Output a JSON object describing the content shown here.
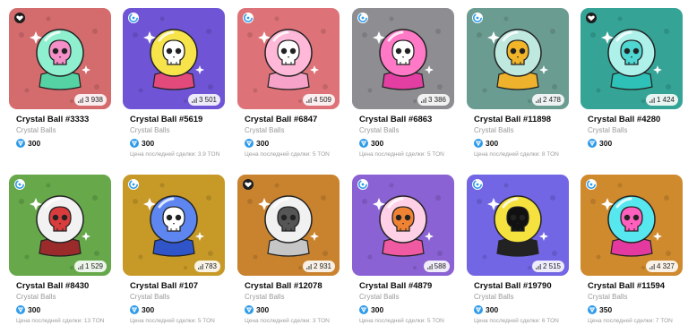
{
  "colors": {
    "ton": "#2f9bea",
    "name_text": "#0b0b0b",
    "muted_text": "#9a9a9a"
  },
  "cards": [
    {
      "name": "Crystal Ball #3333",
      "collection": "Crystal Balls",
      "price": "300",
      "count": "3 938",
      "last_sale": "",
      "mark": "heart-badge-icon",
      "bg": "#d46c6e",
      "ball": "#8ef0cf",
      "skull": "#f58fc8",
      "base": "#56d3a5"
    },
    {
      "name": "Crystal Ball #5619",
      "collection": "Crystal Balls",
      "price": "300",
      "count": "3 501",
      "last_sale": "Цена последней сделки: 3.9 TON",
      "mark": "verified-badge-icon",
      "bg": "#6f55d6",
      "ball": "#f7e34a",
      "skull": "#ffffff",
      "base": "#e34a7c"
    },
    {
      "name": "Crystal Ball #6847",
      "collection": "Crystal Balls",
      "price": "300",
      "count": "4 509",
      "last_sale": "Цена последней сделки: 5 TON",
      "mark": "verified-badge-icon",
      "bg": "#dd7378",
      "ball": "#ffb8d8",
      "skull": "#ffffff",
      "base": "#f7a3c9"
    },
    {
      "name": "Crystal Ball #6863",
      "collection": "Crystal Balls",
      "price": "300",
      "count": "3 386",
      "last_sale": "Цена последней сделки: 5 TON",
      "mark": "verified-badge-icon",
      "bg": "#8d8d92",
      "ball": "#ff79c6",
      "skull": "#ffffff",
      "base": "#e33fa3"
    },
    {
      "name": "Crystal Ball #11898",
      "collection": "Crystal Balls",
      "price": "300",
      "count": "2 478",
      "last_sale": "Цена последней сделки: 8 TON",
      "mark": "verified-badge-icon",
      "bg": "#6b9c91",
      "ball": "#bfe8de",
      "skull": "#f2b52a",
      "base": "#efb22c"
    },
    {
      "name": "Crystal Ball #4280",
      "collection": "Crystal Balls",
      "price": "300",
      "count": "1 424",
      "last_sale": "",
      "mark": "heart-badge-icon",
      "bg": "#35a396",
      "ball": "#aef0ea",
      "skull": "#4fd7d2",
      "base": "#2dc1b7"
    },
    {
      "name": "Crystal Ball #8430",
      "collection": "Crystal Balls",
      "price": "300",
      "count": "1 529",
      "last_sale": "Цена последней сделки: 13 TON",
      "mark": "verified-badge-icon",
      "bg": "#66a84a",
      "ball": "#f2f2f2",
      "skull": "#d93c3c",
      "base": "#9b2b2b"
    },
    {
      "name": "Crystal Ball #107",
      "collection": "Crystal Balls",
      "price": "300",
      "count": "783",
      "last_sale": "Цена последней сделки: 5 TON",
      "mark": "verified-badge-icon",
      "bg": "#c79a28",
      "ball": "#5e86f0",
      "skull": "#ffffff",
      "base": "#2f55c8"
    },
    {
      "name": "Crystal Ball #12078",
      "collection": "Crystal Balls",
      "price": "300",
      "count": "2 931",
      "last_sale": "Цена последней сделки: 3 TON",
      "mark": "heart-badge-icon",
      "bg": "#c9832f",
      "ball": "#f1f1f1",
      "skull": "#555555",
      "base": "#c6c6c6"
    },
    {
      "name": "Crystal Ball #4879",
      "collection": "Crystal Balls",
      "price": "300",
      "count": "588",
      "last_sale": "Цена последней сделки: 5 TON",
      "mark": "verified-badge-icon",
      "bg": "#8a62d3",
      "ball": "#ffd0e6",
      "skull": "#f08233",
      "base": "#ef5aa2"
    },
    {
      "name": "Crystal Ball #19790",
      "collection": "Crystal Balls",
      "price": "300",
      "count": "2 515",
      "last_sale": "Цена последней сделки: 6 TON",
      "mark": "verified-badge-icon",
      "bg": "#7266e4",
      "ball": "#f5e23f",
      "skull": "#111111",
      "base": "#222222"
    },
    {
      "name": "Crystal Ball #11594",
      "collection": "Crystal Balls",
      "price": "350",
      "count": "4 327",
      "last_sale": "Цена последней сделки: 7 TON",
      "mark": "verified-badge-icon",
      "bg": "#cf8a2e",
      "ball": "#57e7ee",
      "skull": "#ff5fbd",
      "base": "#e43aa0"
    }
  ]
}
